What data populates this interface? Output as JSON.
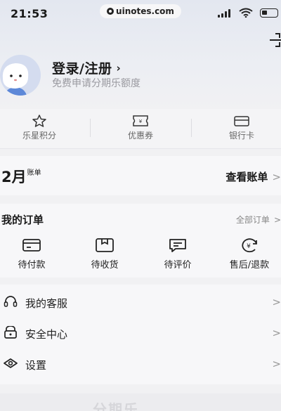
{
  "status_bar": {
    "time": "21:53",
    "url": "uinotes.com",
    "icons": [
      "signal-icon",
      "wifi-icon",
      "battery-icon"
    ]
  },
  "header": {
    "scan_icon": "scan-icon"
  },
  "profile": {
    "title": "登录/注册",
    "chevron": "›",
    "subtitle": "免费申请分期乐额度"
  },
  "quick": [
    {
      "label": "乐星积分",
      "icon": "star-points-icon"
    },
    {
      "label": "优惠券",
      "icon": "coupon-icon"
    },
    {
      "label": "银行卡",
      "icon": "bank-card-icon"
    }
  ],
  "bill": {
    "month": "2月",
    "suffix": "账单",
    "link": "查看账单",
    "chevron": ">"
  },
  "orders": {
    "title": "我的订单",
    "all": "全部订单",
    "chevron": ">",
    "items": [
      {
        "label": "待付款",
        "icon": "wallet-icon"
      },
      {
        "label": "待收货",
        "icon": "package-icon"
      },
      {
        "label": "待评价",
        "icon": "comment-icon"
      },
      {
        "label": "售后/退款",
        "icon": "refund-icon"
      }
    ]
  },
  "menu": [
    {
      "label": "我的客服",
      "icon": "headset-icon",
      "chevron": ">"
    },
    {
      "label": "安全中心",
      "icon": "shield-icon",
      "chevron": ">"
    },
    {
      "label": "设置",
      "icon": "settings-eye-icon",
      "chevron": ">"
    }
  ],
  "footer": {
    "brand": "分期乐"
  }
}
